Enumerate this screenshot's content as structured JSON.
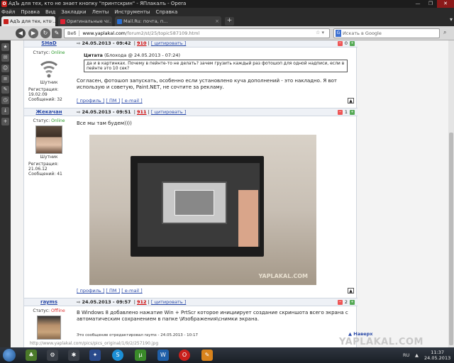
{
  "window": {
    "title": "АдЪ для тех, кто не знает кнопку \"принтскрин\" - ЯПлакалъ - Opera",
    "badge": "O"
  },
  "menu": [
    "Файл",
    "Правка",
    "Вид",
    "Закладки",
    "Ленты",
    "Инструменты",
    "Справка"
  ],
  "tabs": [
    {
      "label": "АдЪ для тех, кто ...",
      "active": true
    },
    {
      "label": "Оригинальные ч...",
      "active": false
    },
    {
      "label": "Mail.Ru: почта, п...",
      "active": false
    }
  ],
  "address": {
    "web_label": "Веб",
    "url_host": "www.yaplakal.com",
    "url_prefix": "",
    "url_path": "/forum2/st/25/topic587109.html",
    "search_placeholder": "Искать в Google",
    "search_engine": "G"
  },
  "posts": [
    {
      "user": "SHaD",
      "time": "24.05.2013 - 09:42",
      "num": "910",
      "quote_label": "[ цитировать ]",
      "status_label": "Статус:",
      "status": "Online",
      "rank": "Шутник",
      "reg": "Регистрация: 19.02.09",
      "msgs": "Сообщений: 32",
      "rating": "0",
      "quote_title": "Цитата",
      "quote_author": "(Блохода @ 24.05.2013 - 07:24)",
      "quote_text": "да и в картинках. Почему в пейнте-то не делать? зачем грузить каждый раз фотошоп для одной надписи, если в пейнте это 10 сек?",
      "text": "Согласен, фотошоп запускать, особенно если установлено куча дополнений - это накладно. Я вот использую и советую, Paint.NET, не сочтите за рекламу."
    },
    {
      "user": "Жекачан",
      "time": "24.05.2013 - 09:51",
      "num": "911",
      "quote_label": "[ цитировать ]",
      "status_label": "Статус:",
      "status": "Online",
      "rank": "Шутник",
      "reg": "Регистрация: 21.06.12",
      "msgs": "Сообщений: 41",
      "rating": "1",
      "text": "Все мы там будем))))",
      "watermark": "YAPLAKAL.COM"
    },
    {
      "user": "rayms",
      "time": "24.05.2013 - 09:57",
      "num": "912",
      "quote_label": "[ цитировать ]",
      "status_label": "Статус:",
      "status": "Offline",
      "rating": "2",
      "text1": "В Windows 8 добавлено нажатие Win + PrtScr которое инициирует создание скриншота всего экрана с",
      "text2": "автоматическим сохранением в папке \\Изображения\\снимки экрана.",
      "edited": "Это сообщение отредактировал rayms - 24.05.2013 - 10:17"
    }
  ],
  "footlinks": {
    "profile": "[ профиль ]",
    "pm": "[ ПМ ]",
    "email": "[ e-mail ]"
  },
  "naverh": "▲ Наверх",
  "status_bar_url": "http://www.yaplakal.com/pics/pics_original/1/9/2/257190.jpg",
  "brand_watermark": "YAPLAKAL.COM",
  "taskbar": {
    "lang": "RU",
    "time": "11:37",
    "date": "24.05.2013"
  }
}
